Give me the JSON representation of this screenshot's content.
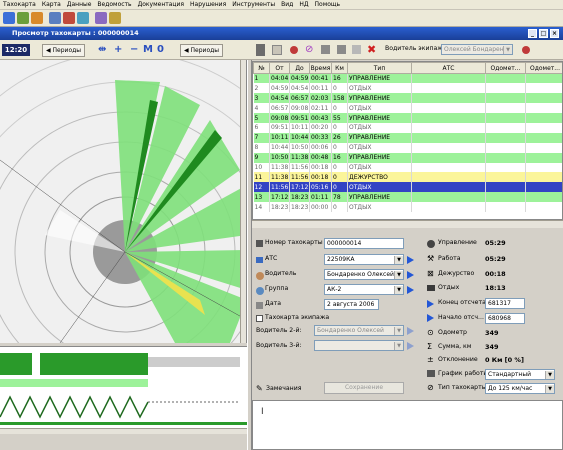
{
  "menu": [
    "Тахокарта",
    "Карта",
    "Данные",
    "Ведомость",
    "Документация",
    "Нарушения",
    "Инструменты",
    "Вид",
    "НД",
    "Помощь"
  ],
  "window": {
    "title": "Просмотр тахокарты : 000000014"
  },
  "toolbar2": {
    "time": "12:20",
    "periods_left": "Периоды",
    "periods_right": "Периоды",
    "zoom_m": "M",
    "zoom_0": "0",
    "driver_label": "Водитель экипажа:",
    "driver_value": "Олексей Бондаренко"
  },
  "table": {
    "headers": [
      "№",
      "От",
      "До",
      "Время",
      "Км",
      "Тип",
      "АТС",
      "Одомет...",
      "Одомет..."
    ],
    "rows": [
      {
        "n": "1",
        "from": "04:04",
        "to": "04:59",
        "time": "00:41",
        "km": "16",
        "type": "УПРАВЛЕНИЕ",
        "style": "green"
      },
      {
        "n": "2",
        "from": "04:59",
        "to": "04:54",
        "time": "00:11",
        "km": "0",
        "type": "ОТДЫХ",
        "style": "white"
      },
      {
        "n": "3",
        "from": "04:54",
        "to": "06:57",
        "time": "02:03",
        "km": "158",
        "type": "УПРАВЛЕНИЕ",
        "style": "green"
      },
      {
        "n": "4",
        "from": "06:57",
        "to": "09:08",
        "time": "02:11",
        "km": "0",
        "type": "ОТДЫХ",
        "style": "white"
      },
      {
        "n": "5",
        "from": "09:08",
        "to": "09:51",
        "time": "00:43",
        "km": "55",
        "type": "УПРАВЛЕНИЕ",
        "style": "green"
      },
      {
        "n": "6",
        "from": "09:51",
        "to": "10:11",
        "time": "00:20",
        "km": "0",
        "type": "ОТДЫХ",
        "style": "white"
      },
      {
        "n": "7",
        "from": "10:11",
        "to": "10:44",
        "time": "00:33",
        "km": "26",
        "type": "УПРАВЛЕНИЕ",
        "style": "green"
      },
      {
        "n": "8",
        "from": "10:44",
        "to": "10:50",
        "time": "00:06",
        "km": "0",
        "type": "ОТДЫХ",
        "style": "white"
      },
      {
        "n": "9",
        "from": "10:50",
        "to": "11:38",
        "time": "00:48",
        "km": "16",
        "type": "УПРАВЛЕНИЕ",
        "style": "green"
      },
      {
        "n": "10",
        "from": "11:38",
        "to": "11:56",
        "time": "00:18",
        "km": "0",
        "type": "ОТДЫХ",
        "style": "white"
      },
      {
        "n": "11",
        "from": "11:38",
        "to": "11:56",
        "time": "00:18",
        "km": "0",
        "type": "ДЕЖУРСТВО",
        "style": "yellow"
      },
      {
        "n": "12",
        "from": "11:56",
        "to": "17:12",
        "time": "05:16",
        "km": "0",
        "type": "ОТДЫХ",
        "style": "sel"
      },
      {
        "n": "13",
        "from": "17:12",
        "to": "18:23",
        "time": "01:11",
        "km": "78",
        "type": "УПРАВЛЕНИЕ",
        "style": "green"
      },
      {
        "n": "14",
        "from": "18:23",
        "to": "18:23",
        "time": "00:00",
        "km": "0",
        "type": "ОТДЫХ",
        "style": "white"
      }
    ]
  },
  "form": {
    "card_number_label": "Номер тахокарты",
    "card_number": "000000014",
    "ats_label": "АТС",
    "ats": "22509КА",
    "driver_label": "Водитель",
    "driver": "Бондаренко Олексей",
    "group_label": "Группа",
    "group": "АК-2",
    "date_label": "Дата",
    "date": "2 августа 2006",
    "crew_checkbox": "Тахокарта экипажа",
    "driver2_label": "Водитель 2-й:",
    "driver2": "Бондаренко Олексей",
    "driver3_label": "Водитель 3-й:",
    "notes_label": "Замечания",
    "save_label": "Сохранение"
  },
  "stats": {
    "management_label": "Управление",
    "management": "05:29",
    "work_label": "Работа",
    "work": "05:29",
    "duty_label": "Дежурство",
    "duty": "00:18",
    "rest_label": "Отдых",
    "rest": "18:13",
    "end_counter_label": "Конец отсчета",
    "end_counter": "681317",
    "start_counter_label": "Начало отсч...",
    "start_counter": "680968",
    "odometer_label": "Одометр",
    "odometer": "349",
    "sum_label": "Сумма, км",
    "sum": "349",
    "deviation_label": "Отклонение",
    "deviation": "0 Км [0 %]",
    "schedule_label": "График работы",
    "schedule": "Стандартный",
    "tacho_type_label": "Тип тахокарты",
    "tacho_type": "До 125 км/час"
  },
  "colors": {
    "green": "#9df29a",
    "selection": "#3343c4",
    "yellow": "#fbf59a",
    "accent": "#2357d6"
  }
}
